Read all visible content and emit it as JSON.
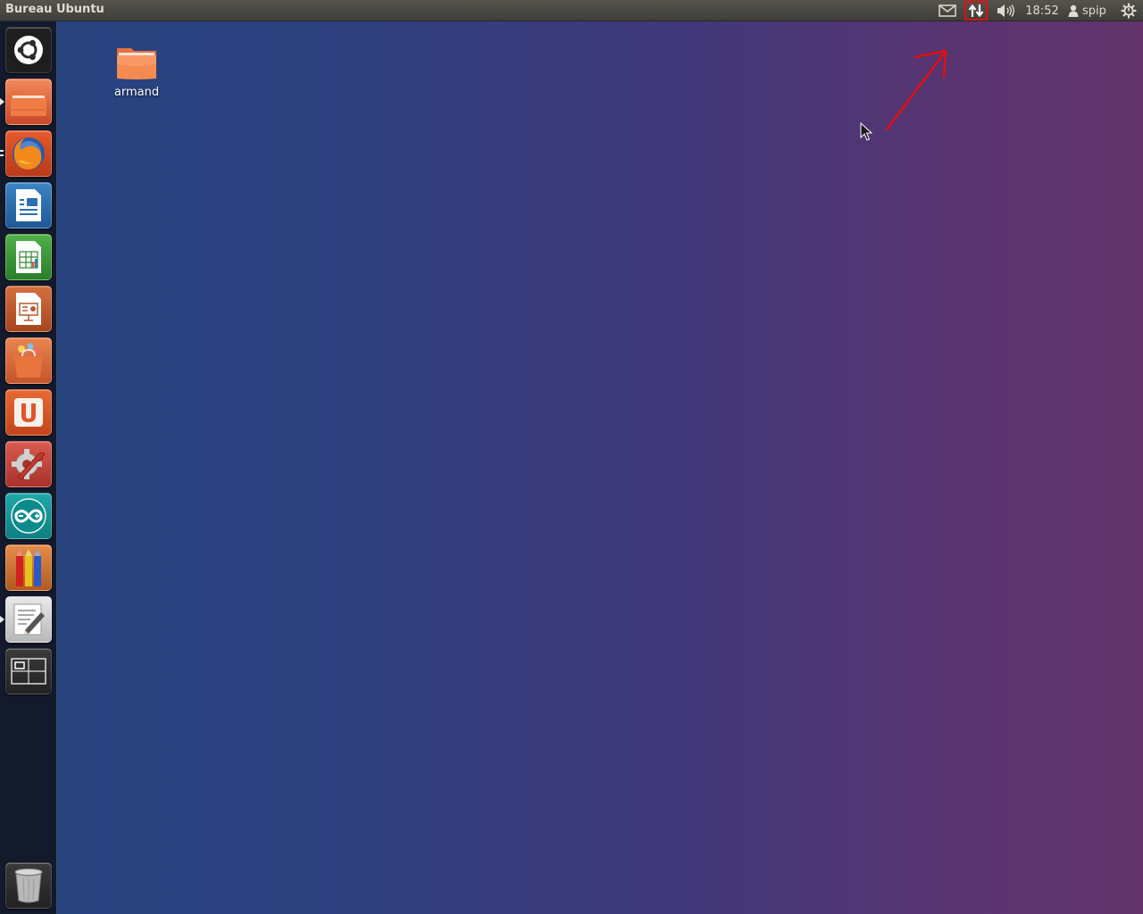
{
  "panel": {
    "title": "Bureau Ubuntu",
    "indicators": {
      "mail_icon": "envelope-icon",
      "network_icon": "network-updown-arrows-icon",
      "sound_icon": "speaker-icon",
      "clock": "18:52",
      "user_icon": "person-icon",
      "user_name": "spip",
      "session_icon": "gear-power-icon"
    },
    "highlight_color": "#e01010"
  },
  "launcher": {
    "items": [
      {
        "name": "dash-home",
        "icon": "ubuntu-logo-icon"
      },
      {
        "name": "files",
        "icon": "folder-icon",
        "running": "single"
      },
      {
        "name": "firefox",
        "icon": "firefox-icon",
        "running": "double"
      },
      {
        "name": "libreoffice-writer",
        "icon": "writer-document-icon"
      },
      {
        "name": "libreoffice-calc",
        "icon": "calc-spreadsheet-icon"
      },
      {
        "name": "libreoffice-impress",
        "icon": "impress-presentation-icon"
      },
      {
        "name": "software-center",
        "icon": "shopping-bag-icon"
      },
      {
        "name": "ubuntu-one",
        "icon": "ubuntu-one-icon"
      },
      {
        "name": "system-settings",
        "icon": "settings-wrench-gear-icon"
      },
      {
        "name": "arduino",
        "icon": "arduino-infinity-icon"
      },
      {
        "name": "drawing",
        "icon": "colored-pencils-icon"
      },
      {
        "name": "text-editor",
        "icon": "text-editor-icon",
        "running": "single"
      },
      {
        "name": "workspace-switcher",
        "icon": "workspace-switcher-icon"
      }
    ],
    "trash": {
      "icon": "trash-icon"
    }
  },
  "desktop": {
    "icons": [
      {
        "label": "armand",
        "icon": "folder-icon"
      }
    ],
    "annotation_color": "#e01010"
  }
}
